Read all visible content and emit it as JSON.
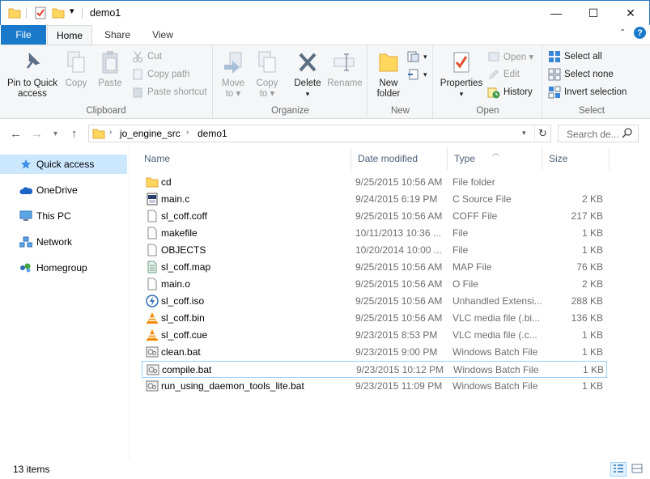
{
  "window": {
    "title": "demo1",
    "minimize": "—",
    "maximize": "☐",
    "close": "✕"
  },
  "tabs": {
    "file": "File",
    "home": "Home",
    "share": "Share",
    "view": "View"
  },
  "ribbon": {
    "clipboard": {
      "label": "Clipboard",
      "pin_line1": "Pin to Quick",
      "pin_line2": "access",
      "copy": "Copy",
      "paste": "Paste",
      "cut": "Cut",
      "copy_path": "Copy path",
      "paste_shortcut": "Paste shortcut"
    },
    "organize": {
      "label": "Organize",
      "move_line1": "Move",
      "move_line2": "to ▾",
      "copy_line1": "Copy",
      "copy_line2": "to ▾",
      "delete_line1": "Delete",
      "delete_line2": "▾",
      "rename": "Rename"
    },
    "new": {
      "label": "New",
      "new_folder_line1": "New",
      "new_folder_line2": "folder"
    },
    "open": {
      "label": "Open",
      "properties_line1": "Properties",
      "properties_line2": "▾",
      "open": "Open ▾",
      "edit": "Edit",
      "history": "History"
    },
    "select": {
      "label": "Select",
      "select_all": "Select all",
      "select_none": "Select none",
      "invert": "Invert selection"
    }
  },
  "address": {
    "crumbs": [
      "jo_engine_src",
      "demo1"
    ],
    "search_placeholder": "Search de..."
  },
  "nav": {
    "items": [
      {
        "label": "Quick access",
        "icon": "star-icon"
      },
      {
        "label": "OneDrive",
        "icon": "cloud-icon"
      },
      {
        "label": "This PC",
        "icon": "computer-icon"
      },
      {
        "label": "Network",
        "icon": "network-icon"
      },
      {
        "label": "Homegroup",
        "icon": "homegroup-icon"
      }
    ]
  },
  "columns": {
    "name": "Name",
    "date": "Date modified",
    "type": "Type",
    "size": "Size"
  },
  "files": [
    {
      "name": "cd",
      "date": "9/25/2015 10:56 AM",
      "type": "File folder",
      "size": "",
      "icon": "folder-icon"
    },
    {
      "name": "main.c",
      "date": "9/24/2015 6:19 PM",
      "type": "C Source File",
      "size": "2 KB",
      "icon": "c-source-icon"
    },
    {
      "name": "sl_coff.coff",
      "date": "9/25/2015 10:56 AM",
      "type": "COFF File",
      "size": "217 KB",
      "icon": "generic-file-icon"
    },
    {
      "name": "makefile",
      "date": "10/11/2013 10:36 ...",
      "type": "File",
      "size": "1 KB",
      "icon": "generic-file-icon"
    },
    {
      "name": "OBJECTS",
      "date": "10/20/2014 10:00 ...",
      "type": "File",
      "size": "1 KB",
      "icon": "generic-file-icon"
    },
    {
      "name": "sl_coff.map",
      "date": "9/25/2015 10:56 AM",
      "type": "MAP File",
      "size": "76 KB",
      "icon": "map-file-icon"
    },
    {
      "name": "main.o",
      "date": "9/25/2015 10:56 AM",
      "type": "O File",
      "size": "2 KB",
      "icon": "generic-file-icon"
    },
    {
      "name": "sl_coff.iso",
      "date": "9/25/2015 10:56 AM",
      "type": "Unhandled Extensi...",
      "size": "288 KB",
      "icon": "daemon-tools-icon"
    },
    {
      "name": "sl_coff.bin",
      "date": "9/25/2015 10:56 AM",
      "type": "VLC media file (.bi...",
      "size": "136 KB",
      "icon": "vlc-icon"
    },
    {
      "name": "sl_coff.cue",
      "date": "9/23/2015 8:53 PM",
      "type": "VLC media file (.c...",
      "size": "1 KB",
      "icon": "vlc-icon"
    },
    {
      "name": "clean.bat",
      "date": "9/23/2015 9:00 PM",
      "type": "Windows Batch File",
      "size": "1 KB",
      "icon": "batch-file-icon"
    },
    {
      "name": "compile.bat",
      "date": "9/23/2015 10:12 PM",
      "type": "Windows Batch File",
      "size": "1 KB",
      "icon": "batch-file-icon"
    },
    {
      "name": "run_using_daemon_tools_lite.bat",
      "date": "9/23/2015 11:09 PM",
      "type": "Windows Batch File",
      "size": "1 KB",
      "icon": "batch-file-icon"
    }
  ],
  "focused_file": "compile.bat",
  "status": {
    "items": "13 items"
  },
  "colors": {
    "accent": "#1979ca",
    "selection": "#cce8ff",
    "focus_border": "#99d1ff"
  }
}
